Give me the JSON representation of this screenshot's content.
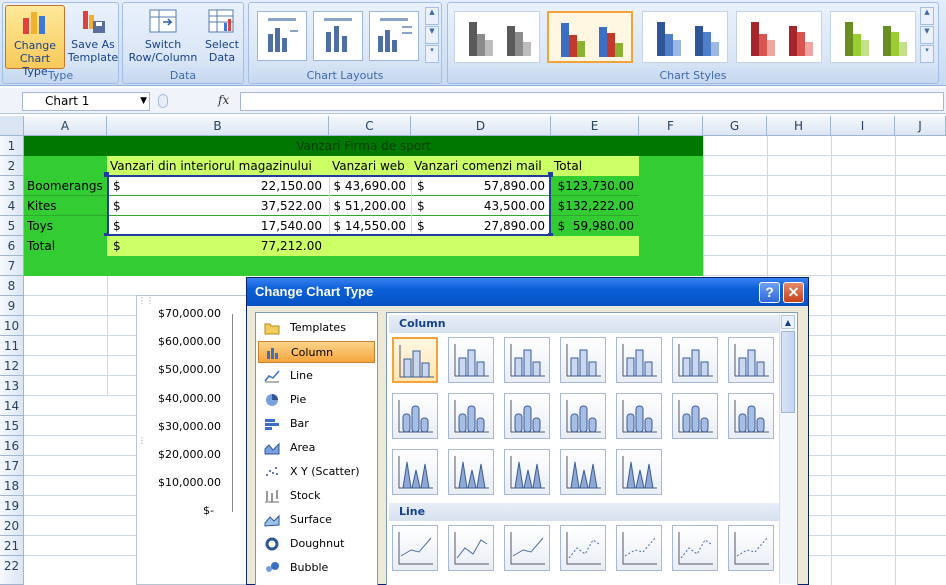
{
  "ribbon": {
    "groups": [
      {
        "label": "Type",
        "buttons": [
          {
            "label1": "Change",
            "label2": "Chart Type"
          },
          {
            "label1": "Save As",
            "label2": "Template"
          }
        ]
      },
      {
        "label": "Data",
        "buttons": [
          {
            "label1": "Switch",
            "label2": "Row/Column"
          },
          {
            "label1": "Select",
            "label2": "Data"
          }
        ]
      },
      {
        "label": "Chart Layouts"
      },
      {
        "label": "Chart Styles"
      }
    ]
  },
  "formula_bar": {
    "name_box": "Chart 1",
    "fx": "fx",
    "value": ""
  },
  "sheet": {
    "columns": [
      "A",
      "B",
      "C",
      "D",
      "E",
      "F",
      "G",
      "H",
      "I",
      "J"
    ],
    "rows": [
      "1",
      "2",
      "3",
      "4",
      "5",
      "6",
      "7",
      "8",
      "9",
      "10",
      "11",
      "12",
      "13",
      "14",
      "15",
      "16",
      "17",
      "18",
      "19",
      "20",
      "21",
      "22"
    ],
    "title": "Vanzari Firma de sport",
    "headers": [
      "Vanzari din interiorul magazinului",
      "Vanzari web",
      "Vanzari comenzi mail",
      "Total"
    ],
    "data_rows": [
      {
        "label": "Boomerangs",
        "b_cur": "$",
        "b": "22,150.00",
        "c": "$ 43,690.00",
        "d_cur": "$",
        "d": "57,890.00",
        "e": "$123,730.00"
      },
      {
        "label": "Kites",
        "b_cur": "$",
        "b": "37,522.00",
        "c": "$ 51,200.00",
        "d_cur": "$",
        "d": "43,500.00",
        "e": "$132,222.00"
      },
      {
        "label": "Toys",
        "b_cur": "$",
        "b": "17,540.00",
        "c": "$ 14,550.00",
        "d_cur": "$",
        "d": "27,890.00",
        "e": "$  59,980.00"
      }
    ],
    "total_row": {
      "label": "Total",
      "b_cur": "$",
      "b": "77,212.00"
    }
  },
  "chart": {
    "y_ticks": [
      "$70,000.00",
      "$60,000.00",
      "$50,000.00",
      "$40,000.00",
      "$30,000.00",
      "$20,000.00",
      "$10,000.00",
      "$-"
    ]
  },
  "dialog": {
    "title": "Change Chart Type",
    "help": "?",
    "close": "✕",
    "categories": [
      "Templates",
      "Column",
      "Line",
      "Pie",
      "Bar",
      "Area",
      "X Y (Scatter)",
      "Stock",
      "Surface",
      "Doughnut",
      "Bubble"
    ],
    "selected_category": "Column",
    "sections": [
      "Column",
      "Line"
    ]
  },
  "colors": {
    "title_row": "#007700",
    "green_fill": "#33cc33",
    "lime_fill": "#ccff66",
    "accent": "#f2a33a"
  }
}
